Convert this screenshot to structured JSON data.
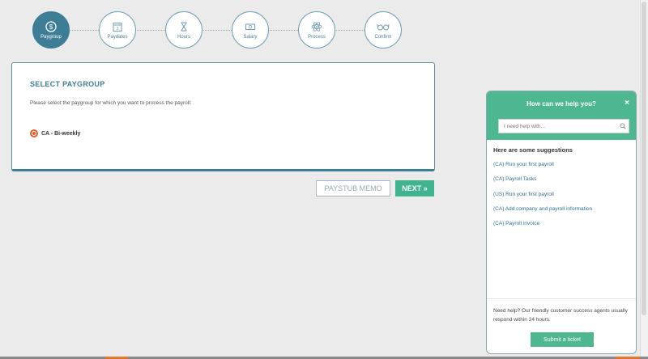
{
  "steps": [
    {
      "label": "Paygroup",
      "icon": "dollar-circle-icon",
      "active": true
    },
    {
      "label": "Paydates",
      "icon": "calendar-icon",
      "active": false
    },
    {
      "label": "Hours",
      "icon": "hourglass-icon",
      "active": false
    },
    {
      "label": "Salary",
      "icon": "money-icon",
      "active": false
    },
    {
      "label": "Process",
      "icon": "atom-icon",
      "active": false
    },
    {
      "label": "Confirm",
      "icon": "glasses-icon",
      "active": false
    }
  ],
  "card": {
    "title": "SELECT PAYGROUP",
    "description": "Please select the paygroup for which you want to process the payroll:",
    "option_label": "CA - Bi-weekly"
  },
  "buttons": {
    "memo": "PAYSTUB MEMO",
    "next": "NEXT »"
  },
  "help": {
    "title": "How can we help you?",
    "close": "×",
    "search_placeholder": "I need help with...",
    "suggestions_title": "Here are some suggestions",
    "suggestions": [
      "(CA) Run your first payroll",
      "(CA) Payroll Tasks",
      "(US) Run your first payroll",
      "(CA) Add company and payroll information",
      "(CA) Payroll invoice"
    ],
    "footer": "Need help? Our friendly customer success agents usually respond within 24 hours.",
    "ticket_button": "Submit a ticket"
  },
  "colors": {
    "primary": "#3d7d96",
    "accent_green": "#4db790",
    "radio_orange": "#e0622b"
  }
}
